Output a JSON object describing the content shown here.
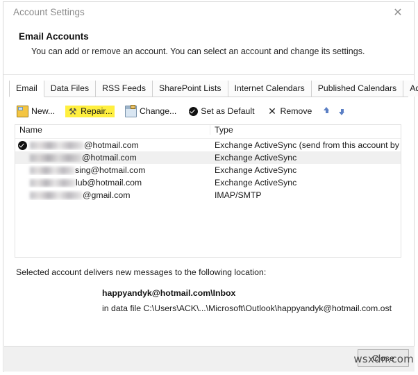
{
  "window": {
    "title": "Account Settings",
    "close_icon": "close-icon"
  },
  "header": {
    "title": "Email Accounts",
    "description": "You can add or remove an account. You can select an account and change its settings."
  },
  "tabs": [
    {
      "label": "Email",
      "active": true
    },
    {
      "label": "Data Files",
      "active": false
    },
    {
      "label": "RSS Feeds",
      "active": false
    },
    {
      "label": "SharePoint Lists",
      "active": false
    },
    {
      "label": "Internet Calendars",
      "active": false
    },
    {
      "label": "Published Calendars",
      "active": false
    },
    {
      "label": "Address Books",
      "active": false
    }
  ],
  "toolbar": {
    "new_label": "New...",
    "repair_label": "Repair...",
    "change_label": "Change...",
    "set_default_label": "Set as Default",
    "remove_label": "Remove",
    "move_up_icon": "arrow-up-icon",
    "move_down_icon": "arrow-down-icon",
    "highlight_color": "#ffef3f"
  },
  "accounts_table": {
    "columns": [
      "Name",
      "Type"
    ],
    "rows": [
      {
        "name_redacted": true,
        "name_visible": "@hotmail.com",
        "redacted_width": 78,
        "type": "Exchange ActiveSync (send from this account by def...",
        "is_default": true,
        "selected": false
      },
      {
        "name_redacted": true,
        "name_visible": "@hotmail.com",
        "redacted_width": 75,
        "type": "Exchange ActiveSync",
        "is_default": false,
        "selected": true
      },
      {
        "name_redacted": true,
        "name_visible": "sing@hotmail.com",
        "redacted_width": 65,
        "type": "Exchange ActiveSync",
        "is_default": false,
        "selected": false
      },
      {
        "name_redacted": true,
        "name_visible": "lub@hotmail.com",
        "redacted_width": 66,
        "type": "Exchange ActiveSync",
        "is_default": false,
        "selected": false
      },
      {
        "name_redacted": true,
        "name_visible": "@gmail.com",
        "redacted_width": 76,
        "type": "IMAP/SMTP",
        "is_default": false,
        "selected": false
      }
    ]
  },
  "delivery": {
    "label": "Selected account delivers new messages to the following location:",
    "target": "happyandyk@hotmail.com\\Inbox",
    "data_file": "in data file C:\\Users\\ACK\\...\\Microsoft\\Outlook\\happyandyk@hotmail.com.ost"
  },
  "footer": {
    "close_label": "Close"
  },
  "watermark": {
    "text": "wsxdn.com"
  }
}
